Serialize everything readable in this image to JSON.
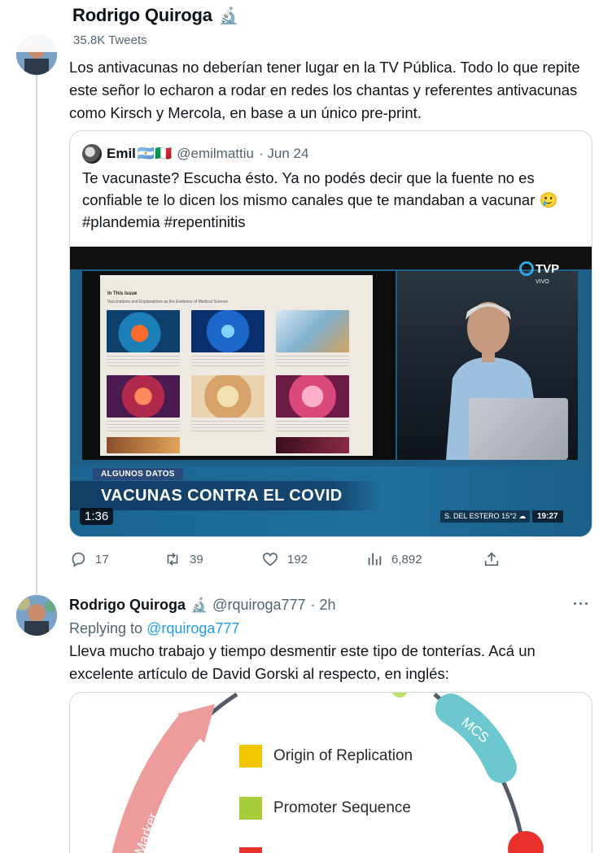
{
  "header": {
    "name": "Rodrigo Quiroga",
    "tweet_count": "35.8K Tweets"
  },
  "tweet1": {
    "text": "Los antivacunas no deberían tener lugar en la TV Pública. Todo lo que repite este señor lo echaron a rodar en redes los chantas y referentes antivacunas como Kirsch y Mercola, en base a un único pre-print.",
    "quote": {
      "name": "Emil",
      "flags": "🇦🇷🇮🇹",
      "handle": "@emilmattiu",
      "date": "· Jun 24",
      "text": "Te vacunaste? Escucha ésto. Ya no podés decir que la fuente no es confiable te lo dicen los mismo canales que te mandaban a vacunar 🥲 #plandemia #repentinitis",
      "video": {
        "channel": "TVP",
        "live": "VIVO",
        "doc_title": "In This Issue",
        "doc_subtitle": "Vaccinations and Explanations as the Evidence of Medical Science",
        "tag": "ALGUNOS DATOS",
        "headline": "VACUNAS CONTRA EL COVID",
        "location": "S. DEL ESTERO  15°2 ☁",
        "clock": "19:27",
        "duration": "1:36"
      }
    },
    "actions": {
      "replies": "17",
      "retweets": "39",
      "likes": "192",
      "views": "6,892"
    }
  },
  "tweet2": {
    "name": "Rodrigo Quiroga",
    "handle": "@rquiroga777",
    "time": "· 2h",
    "more": "···",
    "replying_prefix": "Replying to",
    "replying_to": "@rquiroga777",
    "text": "Lleva mucho trabajo y tiempo desmentir este tipo de tonterías. Acá un excelente artículo de David Gorski al respecto, en inglés:",
    "diagram": {
      "legend": [
        {
          "label": "Origin of Replication",
          "color": "#f2c500"
        },
        {
          "label": "Promoter Sequence",
          "color": "#a6cc3a"
        }
      ],
      "arc_labels": [
        "MCS",
        "Marker"
      ],
      "colors": {
        "marker_arc": "#ee9b9b",
        "mcs_arc": "#6cc7cf",
        "red": "#e8312b",
        "ring": "#555b66"
      }
    }
  }
}
